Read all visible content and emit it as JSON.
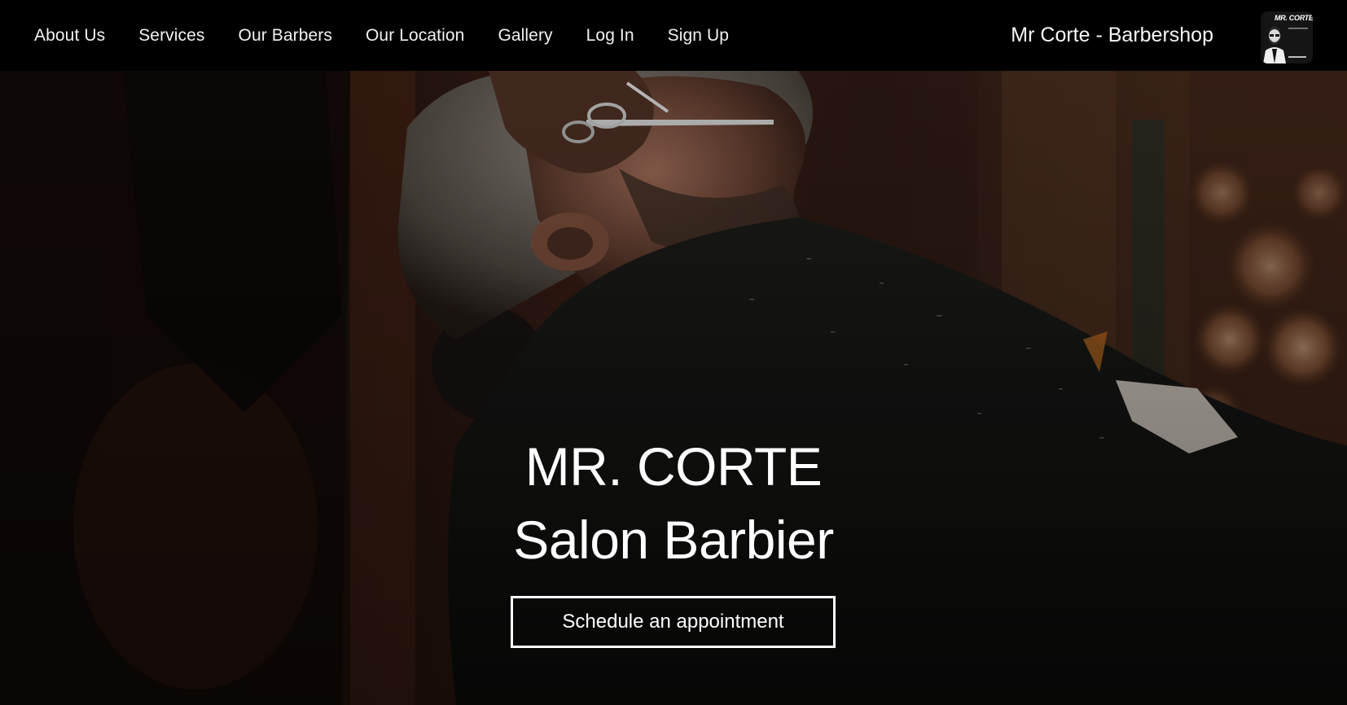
{
  "nav": {
    "items": [
      {
        "label": "About Us",
        "name": "nav-about-us"
      },
      {
        "label": "Services",
        "name": "nav-services"
      },
      {
        "label": "Our Barbers",
        "name": "nav-our-barbers"
      },
      {
        "label": "Our Location",
        "name": "nav-our-location"
      },
      {
        "label": "Gallery",
        "name": "nav-gallery"
      },
      {
        "label": "Log In",
        "name": "nav-log-in"
      },
      {
        "label": "Sign Up",
        "name": "nav-sign-up"
      }
    ],
    "brand": "Mr Corte - Barbershop",
    "logo_text": "MR. CORTE",
    "logo_icon": "barber-portrait-logo"
  },
  "hero": {
    "title": "MR. CORTE",
    "subtitle": "Salon Barbier",
    "cta_label": "Schedule an appointment",
    "background_image": "barber-trimming-beard-photo"
  },
  "colors": {
    "nav_bg": "#000000",
    "text": "#ffffff",
    "hero_dark": "#0b0706",
    "warm_accent": "#d8a070"
  }
}
